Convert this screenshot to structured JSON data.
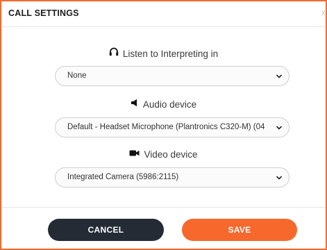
{
  "dialog": {
    "title": "CALL SETTINGS",
    "close_label": "x"
  },
  "interpreting": {
    "label": "Listen to Interpreting in",
    "icon": "headphones-icon",
    "selected": "None"
  },
  "audio": {
    "label": "Audio device",
    "icon": "speaker-icon",
    "selected": "Default - Headset Microphone (Plantronics C320-M) (04"
  },
  "video": {
    "label": "Video device",
    "icon": "video-camera-icon",
    "selected": "Integrated Camera (5986:2115)"
  },
  "buttons": {
    "cancel": "CANCEL",
    "save": "SAVE"
  },
  "colors": {
    "accent": "#f26a2e",
    "save_button": "#f6682c",
    "cancel_button": "#242b35"
  }
}
